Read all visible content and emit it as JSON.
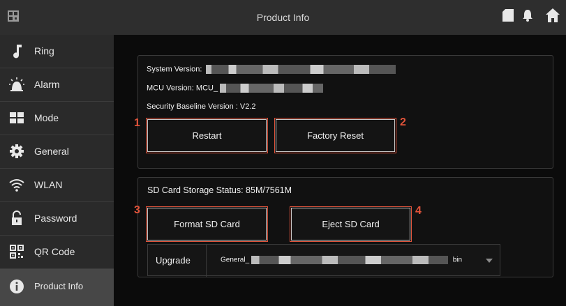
{
  "header": {
    "title": "Product Info"
  },
  "sidebar": {
    "items": [
      {
        "label": "Ring",
        "icon": "music-note-icon"
      },
      {
        "label": "Alarm",
        "icon": "siren-icon"
      },
      {
        "label": "Mode",
        "icon": "grid-icon"
      },
      {
        "label": "General",
        "icon": "gear-icon"
      },
      {
        "label": "WLAN",
        "icon": "wifi-icon"
      },
      {
        "label": "Password",
        "icon": "lock-icon"
      },
      {
        "label": "QR Code",
        "icon": "qr-code-icon"
      },
      {
        "label": "Product Info",
        "icon": "info-icon"
      }
    ],
    "active": "Product Info"
  },
  "system": {
    "system_version_label": "System Version:",
    "mcu_version_label": "MCU Version: MCU_",
    "security_baseline": "Security Baseline Version : V2.2",
    "restart_label": "Restart",
    "factory_reset_label": "Factory Reset"
  },
  "sdcard": {
    "status": "SD Card Storage Status: 85M/7561M",
    "format_label": "Format SD Card",
    "eject_label": "Eject SD Card"
  },
  "upgrade": {
    "label": "Upgrade",
    "file_prefix": "General_",
    "file_suffix": "bin"
  },
  "annotations": [
    "1",
    "2",
    "3",
    "4"
  ],
  "colors": {
    "annotation": "#e0533a",
    "topbar": "#2e2e2e",
    "sidebar": "#2a2a2a",
    "active": "#474747"
  }
}
